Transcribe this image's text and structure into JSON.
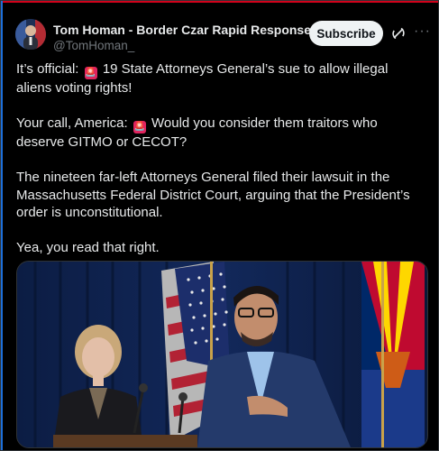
{
  "header": {
    "display_name": "Tom Homan - Border Czar Rapid Response ...",
    "handle": "@TomHoman_",
    "subscribe_label": "Subscribe",
    "more_label": "···"
  },
  "post": {
    "paragraphs": [
      {
        "before": "It’s official: ",
        "after": " 19 State Attorneys General’s sue to allow illegal aliens voting rights!"
      },
      {
        "before": "Your call, America: ",
        "after": " Would you consider them traitors who deserve GITMO or CECOT?"
      },
      {
        "before": "The nineteen far-left Attorneys General filed their lawsuit in the Massachusetts Federal District Court, arguing that the President’s order is unconstitutional.",
        "after": ""
      },
      {
        "before": "Yea, you read that right.",
        "after": ""
      }
    ]
  },
  "colors": {
    "background": "#000000",
    "text": "#e7e9ea",
    "muted": "#71767b",
    "verified": "#1d9bf0",
    "siren": "#e0245e"
  },
  "icons": {
    "verified": "verified-badge-icon",
    "grok": "grok-icon",
    "siren": "police-siren-emoji",
    "more": "more-options-icon"
  }
}
